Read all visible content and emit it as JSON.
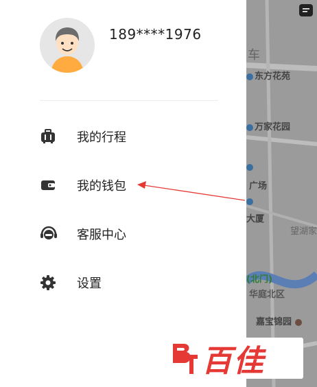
{
  "user": {
    "phone": "189****1976"
  },
  "menu": {
    "items": [
      {
        "label": "我的行程",
        "icon": "suitcase-icon"
      },
      {
        "label": "我的钱包",
        "icon": "wallet-icon"
      },
      {
        "label": "客服中心",
        "icon": "headset-icon"
      },
      {
        "label": "设置",
        "icon": "gear-icon"
      }
    ]
  },
  "map": {
    "labels": [
      "车",
      "东方花苑",
      "万家花园",
      "广场",
      "大厦",
      "望湖家",
      "(北门)",
      "华庭北区",
      "嘉宝锦园"
    ]
  },
  "watermark": {
    "text": "百佳"
  },
  "colors": {
    "arrow": "#e53935",
    "map_bg": "#9b9b9b",
    "watermark": "#e53935"
  }
}
